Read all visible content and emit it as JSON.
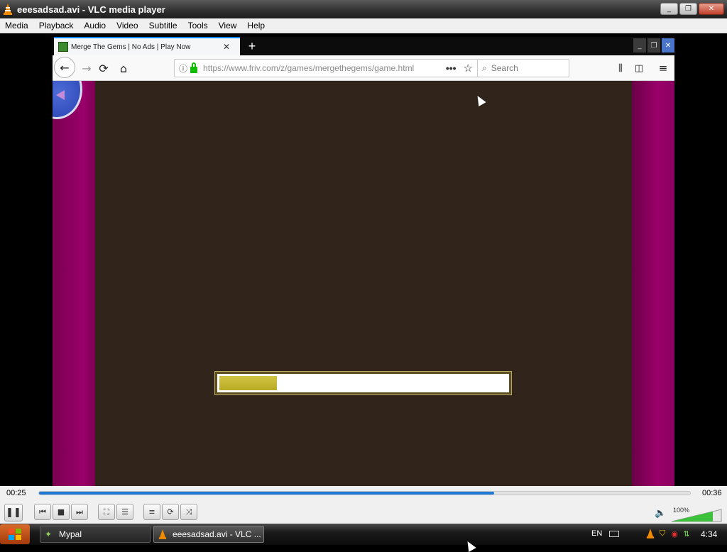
{
  "vlc": {
    "window_title": "eeesadsad.avi - VLC media player",
    "menu": [
      "Media",
      "Playback",
      "Audio",
      "Video",
      "Subtitle",
      "Tools",
      "View",
      "Help"
    ],
    "time_elapsed": "00:25",
    "time_total": "00:36",
    "progress": 0.699,
    "volume_label": "100%",
    "controls": {
      "play_pause": "❚❚",
      "prev": "⏮",
      "stop": "■",
      "next": "⏭",
      "fullscreen": "⛶",
      "extended": "☰",
      "playlist": "≡",
      "loop": "⟳",
      "shuffle": "⤨"
    },
    "window_buttons": {
      "minimize": "_",
      "maximize": "❐",
      "close": "✕"
    }
  },
  "browser": {
    "tab_title": "Merge The Gems | No Ads | Play Now",
    "tab_close": "✕",
    "new_tab": "+",
    "url": "https://www.friv.com/z/games/mergethegems/game.html",
    "search_placeholder": "Search",
    "more_actions": "•••",
    "window_buttons": {
      "minimize": "_",
      "maximize": "❐",
      "close": "✕"
    },
    "icons": {
      "back": "←",
      "forward": "→",
      "reload": "⟳",
      "home": "⌂",
      "info": "ⓘ",
      "star": "☆",
      "search": "⌕",
      "library": "⫼",
      "sidebar": "◫",
      "menu": "≡"
    }
  },
  "game": {
    "loading_progress": 0.2,
    "colors": {
      "canvas": "#31241a",
      "loader_fill": "#c9bb33",
      "side": "#8a005e"
    }
  },
  "taskbar": {
    "items": [
      {
        "label": "Mypal"
      },
      {
        "label": "eeesadsad.avi - VLC ..."
      }
    ],
    "language": "EN",
    "clock": "4:34"
  }
}
